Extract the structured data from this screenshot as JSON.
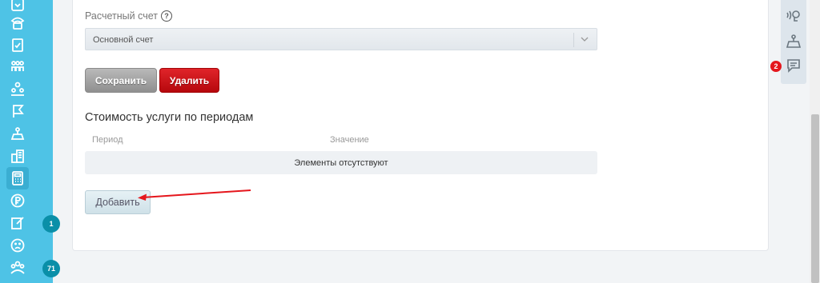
{
  "sidebar": {
    "items": [
      {
        "icon": "phone-icon"
      },
      {
        "icon": "phone-call-icon"
      },
      {
        "icon": "clipboard-check-icon"
      },
      {
        "icon": "org-chart-icon"
      },
      {
        "icon": "users-group-icon"
      },
      {
        "icon": "flag-icon"
      },
      {
        "icon": "weight-scale-icon"
      },
      {
        "icon": "buildings-icon"
      },
      {
        "icon": "calculator-icon",
        "active": true
      },
      {
        "icon": "ruble-coin-icon"
      },
      {
        "icon": "edit-note-icon",
        "badge": "1"
      },
      {
        "icon": "sad-face-icon"
      },
      {
        "icon": "team-icon",
        "badge": "71"
      }
    ],
    "background": "#4ec3e6"
  },
  "form": {
    "account_label": "Расчетный счет",
    "account_help_icon": "question-circle-icon",
    "account_value": "Основной счет",
    "save_label": "Сохранить",
    "delete_label": "Удалить",
    "section_title": "Стоимость услуги по периодам",
    "col_period": "Период",
    "col_value": "Значение",
    "empty_text": "Элементы отсутствуют",
    "add_label": "Добавить"
  },
  "right_panel": {
    "items": [
      {
        "icon": "phone-headset-icon"
      },
      {
        "icon": "scale-icon"
      },
      {
        "icon": "chat-icon",
        "badge": "2"
      }
    ]
  },
  "colors": {
    "accent": "#4ec3e6",
    "danger": "#c8121a",
    "badge_teal": "#0a8fa8",
    "badge_red": "#e4171d"
  }
}
